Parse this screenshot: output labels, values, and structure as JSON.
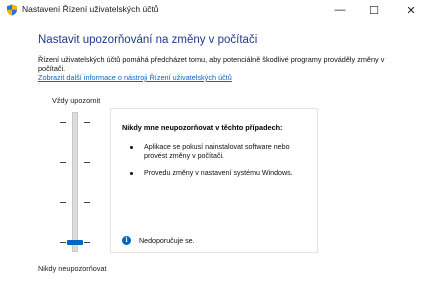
{
  "window": {
    "title": "Nastavení Řízení uživatelských účtů",
    "icon": "uac-shield-icon",
    "minimize_glyph": "—",
    "maximize_glyph": "☐",
    "close_glyph": "✕"
  },
  "heading": "Nastavit upozorňování na změny v počítači",
  "description": "Řízení uživatelských účtů pomáhá předcházet tomu, aby potenciálně škodlivé programy prováděly změny v počítači.",
  "more_info_link": "Zobrazit další informace o nástroji Řízení uživatelských účtů",
  "slider": {
    "top_label": "Vždy upozornit",
    "bottom_label": "Nikdy neupozorňovat",
    "levels": 4,
    "selected_level": 1
  },
  "panel": {
    "title": "Nikdy mne neupozorňovat v těchto případech:",
    "bullets": [
      "Aplikace se pokusí nainstalovat software nebo provést změny v počítači.",
      "Provedu změny v nastavení systému Windows."
    ],
    "info_icon": "info-icon",
    "recommendation": "Nedoporučuje se."
  },
  "colors": {
    "heading": "#1e3a8a",
    "link": "#0b64c5",
    "accent": "#0067c0"
  }
}
